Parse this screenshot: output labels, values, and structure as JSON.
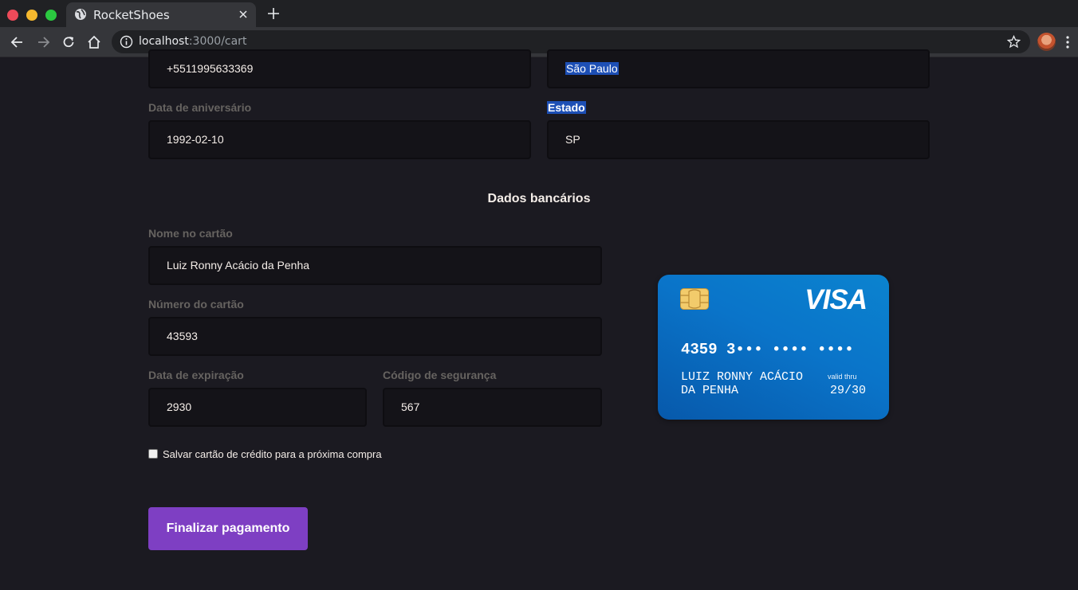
{
  "browser": {
    "tab_title": "RocketShoes",
    "url_host": "localhost",
    "url_path": ":3000/cart"
  },
  "form": {
    "phone_value": "+5511995633369",
    "city_value": "São Paulo",
    "birthday_label": "Data de aniversário",
    "birthday_value": "1992-02-10",
    "state_label": "Estado",
    "state_value": "SP"
  },
  "bank": {
    "section_title": "Dados bancários",
    "card_name_label": "Nome no cartão",
    "card_name_value": "Luiz Ronny Acácio da Penha",
    "card_number_label": "Número do cartão",
    "card_number_value": "43593",
    "expiry_label": "Data de expiração",
    "expiry_value": "2930",
    "cvv_label": "Código de segurança",
    "cvv_value": "567",
    "save_card_label": "Salvar cartão de crédito para a próxima compra",
    "save_card_checked": false,
    "submit_label": "Finalizar pagamento"
  },
  "card_preview": {
    "brand": "VISA",
    "number": "4359 3••• •••• ••••",
    "holder": "LUIZ RONNY ACÁCIO DA PENHA",
    "valid_label": "valid thru",
    "expiry": "29/30"
  },
  "colors": {
    "background": "#1b1a21",
    "accent": "#7e3fc3",
    "card_blue": "#0a74c9",
    "selection": "#1d4fb5"
  },
  "icons": [
    "globe-icon",
    "close-icon",
    "plus-icon",
    "back-arrow-icon",
    "forward-arrow-icon",
    "reload-icon",
    "home-icon",
    "info-icon",
    "star-icon",
    "kebab-menu-icon",
    "chip-icon"
  ]
}
